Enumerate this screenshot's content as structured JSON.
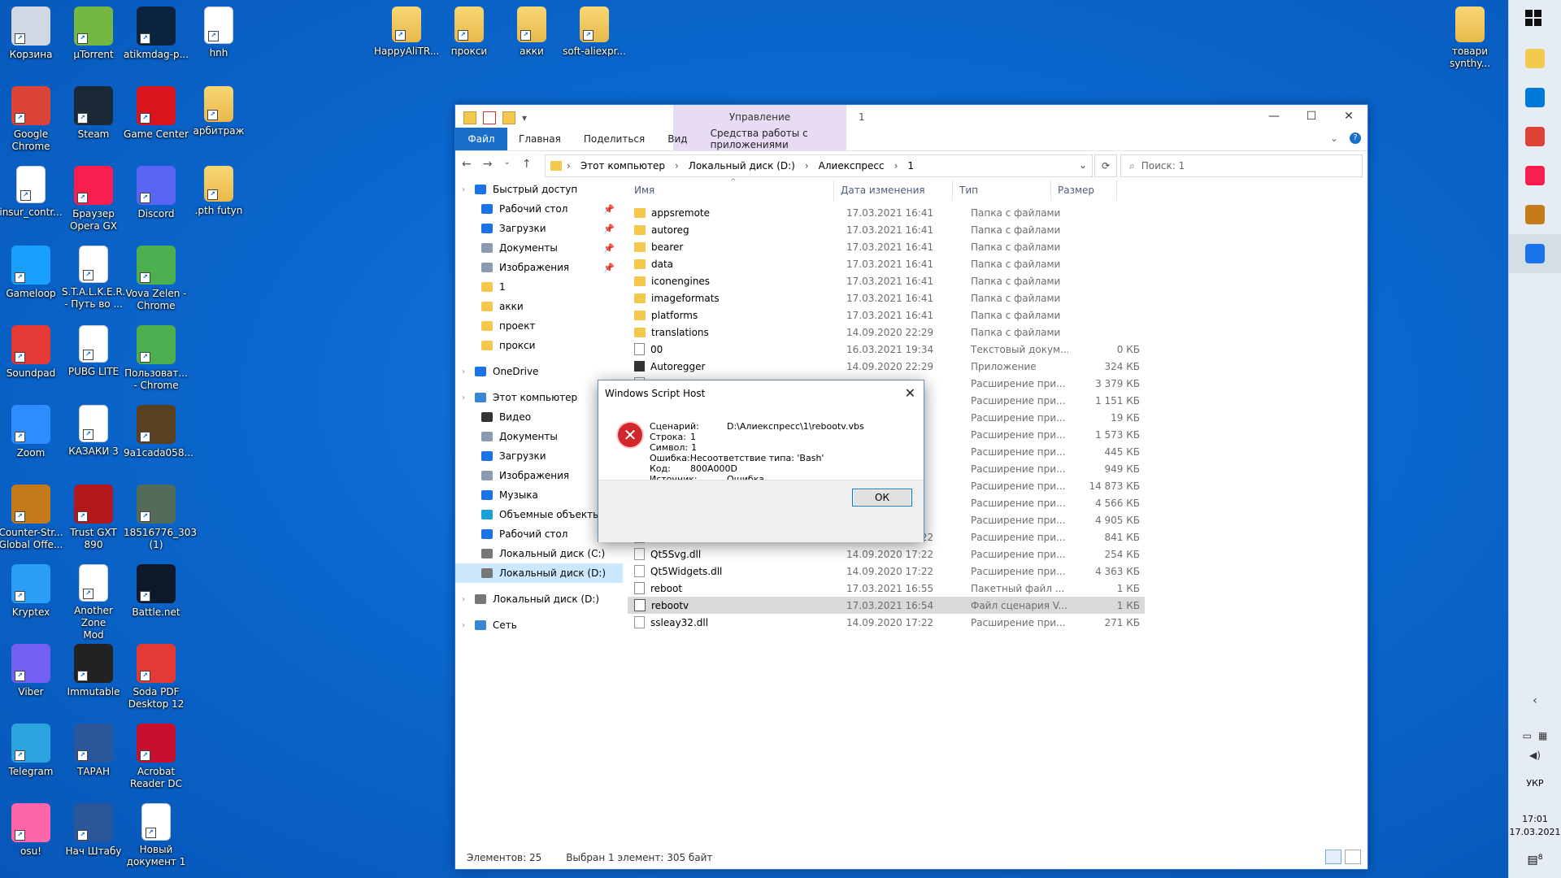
{
  "desktop": {
    "icons_col1": [
      {
        "label": "Корзина",
        "color": "#cfd8e3"
      },
      {
        "label": "Google\nChrome",
        "color": "#db4437"
      },
      {
        "label": "insur_contr...",
        "color": "#ffffff"
      },
      {
        "label": "Gameloop",
        "color": "#19a0ff"
      },
      {
        "label": "Soundpad",
        "color": "#e53935"
      },
      {
        "label": "Zoom",
        "color": "#2d8cff"
      },
      {
        "label": "Counter-Str...\nGlobal Offe...",
        "color": "#c47a1a"
      },
      {
        "label": "Kryptex",
        "color": "#2a9df4"
      },
      {
        "label": "Viber",
        "color": "#7360f2"
      },
      {
        "label": "Telegram",
        "color": "#2aa3df"
      },
      {
        "label": "osu!",
        "color": "#ff66aa"
      }
    ],
    "icons_col2": [
      {
        "label": "µTorrent",
        "color": "#75b841"
      },
      {
        "label": "Steam",
        "color": "#1b2838"
      },
      {
        "label": "Браузер\nOpera GX",
        "color": "#fa1e4e"
      },
      {
        "label": "S.T.A.L.K.E.R.\n- Путь во ...",
        "color": "#ffffff"
      },
      {
        "label": "PUBG LITE",
        "color": "#ffffff"
      },
      {
        "label": "КАЗАКИ 3",
        "color": "#ffffff"
      },
      {
        "label": "Trust GXT 890",
        "color": "#b3161b"
      },
      {
        "label": "Another Zone\nMod",
        "color": "#ffffff"
      },
      {
        "label": "Immutable",
        "color": "#222222"
      },
      {
        "label": "ТАРАН",
        "color": "#2b579a"
      },
      {
        "label": "Нач Штабу",
        "color": "#2b579a"
      }
    ],
    "icons_col3": [
      {
        "label": "atikmdag-p...",
        "color": "#0a2540"
      },
      {
        "label": "Game Center",
        "color": "#d9141c"
      },
      {
        "label": "Discord",
        "color": "#5865f2"
      },
      {
        "label": "Vova Zelen -\nChrome",
        "color": "#4caf50"
      },
      {
        "label": "Пользоват...\n- Chrome",
        "color": "#4caf50"
      },
      {
        "label": "9a1cada058...",
        "color": "#5a4020"
      },
      {
        "label": "18516776_303\n(1)",
        "color": "#556b5a"
      },
      {
        "label": "Battle.net",
        "color": "#0e1a2b"
      },
      {
        "label": "Soda PDF\nDesktop 12",
        "color": "#e53935"
      },
      {
        "label": "Acrobat\nReader DC",
        "color": "#c8102e"
      },
      {
        "label": "Новый\nдокумент 1",
        "color": "#ffffff"
      }
    ],
    "icons_col4": [
      {
        "label": "hnh",
        "color": "#ffffff"
      },
      {
        "label": "арбитраж",
        "color": "#f3c84d"
      },
      {
        "label": ".pth futyn",
        "color": "#f3c84d"
      }
    ],
    "icons_top": [
      {
        "label": "HappyAliTR...",
        "color": "#f3c84d"
      },
      {
        "label": "прокси",
        "color": "#f3c84d"
      },
      {
        "label": "акки",
        "color": "#f3c84d"
      },
      {
        "label": "soft-aliexpr...",
        "color": "#f3c84d"
      }
    ],
    "icon_right": {
      "label": "товари\nsynthy...",
      "color": "#f3c84d"
    }
  },
  "taskbar": {
    "buttons": [
      "windows-icon",
      "file-explorer-icon",
      "mail-icon",
      "chrome-icon",
      "opera-icon",
      "csgo-icon",
      "script-host-icon"
    ],
    "lang": "УКР",
    "time": "17:01",
    "date": "17.03.2021",
    "notifications": "8"
  },
  "explorer": {
    "context_tab_title": "Управление",
    "window_title": "1",
    "ribbon_tabs": [
      "Файл",
      "Главная",
      "Поделиться",
      "Вид",
      "Средства работы с приложениями"
    ],
    "breadcrumbs": [
      "Этот компьютер",
      "Локальный диск (D:)",
      "Алиекспресс",
      "1"
    ],
    "search_placeholder": "Поиск: 1",
    "nav": [
      {
        "label": "Быстрый доступ",
        "icon": "star-icon",
        "color": "#1a73e8",
        "level": 0,
        "pin": false
      },
      {
        "label": "Рабочий стол",
        "icon": "desktop-icon",
        "color": "#1a73e8",
        "level": 1,
        "pin": true
      },
      {
        "label": "Загрузки",
        "icon": "download-icon",
        "color": "#1a73e8",
        "level": 1,
        "pin": true
      },
      {
        "label": "Документы",
        "icon": "documents-icon",
        "color": "#8a9bb0",
        "level": 1,
        "pin": true
      },
      {
        "label": "Изображения",
        "icon": "pictures-icon",
        "color": "#8a9bb0",
        "level": 1,
        "pin": true
      },
      {
        "label": "1",
        "icon": "folder-icon",
        "color": "#f3c84d",
        "level": 1,
        "pin": false
      },
      {
        "label": "акки",
        "icon": "folder-icon",
        "color": "#f3c84d",
        "level": 1,
        "pin": false
      },
      {
        "label": "проект",
        "icon": "folder-icon",
        "color": "#f3c84d",
        "level": 1,
        "pin": false
      },
      {
        "label": "прокси",
        "icon": "folder-icon",
        "color": "#f3c84d",
        "level": 1,
        "pin": false
      },
      {
        "label": "",
        "icon": "",
        "color": "",
        "level": -1,
        "pin": false
      },
      {
        "label": "OneDrive",
        "icon": "cloud-icon",
        "color": "#1a73e8",
        "level": 0,
        "pin": false
      },
      {
        "label": "",
        "icon": "",
        "color": "",
        "level": -1,
        "pin": false
      },
      {
        "label": "Этот компьютер",
        "icon": "computer-icon",
        "color": "#3a86d4",
        "level": 0,
        "pin": false
      },
      {
        "label": "Видео",
        "icon": "video-icon",
        "color": "#333",
        "level": 1,
        "pin": false
      },
      {
        "label": "Документы",
        "icon": "documents-icon",
        "color": "#8a9bb0",
        "level": 1,
        "pin": false
      },
      {
        "label": "Загрузки",
        "icon": "download-icon",
        "color": "#1a73e8",
        "level": 1,
        "pin": false
      },
      {
        "label": "Изображения",
        "icon": "pictures-icon",
        "color": "#8a9bb0",
        "level": 1,
        "pin": false
      },
      {
        "label": "Музыка",
        "icon": "music-icon",
        "color": "#1a73e8",
        "level": 1,
        "pin": false
      },
      {
        "label": "Объемные объекты",
        "icon": "3d-objects-icon",
        "color": "#1aa0d8",
        "level": 1,
        "pin": false
      },
      {
        "label": "Рабочий стол",
        "icon": "desktop-icon",
        "color": "#1a73e8",
        "level": 1,
        "pin": false
      },
      {
        "label": "Локальный диск (C:)",
        "icon": "drive-icon",
        "color": "#777",
        "level": 1,
        "pin": false
      },
      {
        "label": "Локальный диск (D:)",
        "icon": "drive-icon",
        "color": "#777",
        "level": 1,
        "pin": false,
        "selected": true
      },
      {
        "label": "",
        "icon": "",
        "color": "",
        "level": -1,
        "pin": false
      },
      {
        "label": "Локальный диск (D:)",
        "icon": "drive-icon",
        "color": "#777",
        "level": 0,
        "pin": false
      },
      {
        "label": "",
        "icon": "",
        "color": "",
        "level": -1,
        "pin": false
      },
      {
        "label": "Сеть",
        "icon": "network-icon",
        "color": "#3a86d4",
        "level": 0,
        "pin": false
      }
    ],
    "columns": [
      "Имя",
      "Дата изменения",
      "Тип",
      "Размер"
    ],
    "files": [
      {
        "name": "appsremote",
        "date": "17.03.2021 16:41",
        "type": "Папка с файлами",
        "size": "",
        "kind": "folder"
      },
      {
        "name": "autoreg",
        "date": "17.03.2021 16:41",
        "type": "Папка с файлами",
        "size": "",
        "kind": "folder"
      },
      {
        "name": "bearer",
        "date": "17.03.2021 16:41",
        "type": "Папка с файлами",
        "size": "",
        "kind": "folder"
      },
      {
        "name": "data",
        "date": "17.03.2021 16:41",
        "type": "Папка с файлами",
        "size": "",
        "kind": "folder"
      },
      {
        "name": "iconengines",
        "date": "17.03.2021 16:41",
        "type": "Папка с файлами",
        "size": "",
        "kind": "folder"
      },
      {
        "name": "imageformats",
        "date": "17.03.2021 16:41",
        "type": "Папка с файлами",
        "size": "",
        "kind": "folder"
      },
      {
        "name": "platforms",
        "date": "17.03.2021 16:41",
        "type": "Папка с файлами",
        "size": "",
        "kind": "folder"
      },
      {
        "name": "translations",
        "date": "14.09.2020 22:29",
        "type": "Папка с файлами",
        "size": "",
        "kind": "folder"
      },
      {
        "name": "00",
        "date": "16.03.2021 19:34",
        "type": "Текстовый докум...",
        "size": "0 КБ",
        "kind": "txt"
      },
      {
        "name": "Autoregger",
        "date": "14.09.2020 22:29",
        "type": "Приложение",
        "size": "324 КБ",
        "kind": "exe"
      },
      {
        "name": "",
        "date": "",
        "type": "Расширение при...",
        "size": "3 379 КБ",
        "kind": "dll"
      },
      {
        "name": "",
        "date": "",
        "type": "Расширение при...",
        "size": "1 151 КБ",
        "kind": "dll"
      },
      {
        "name": "",
        "date": "",
        "type": "Расширение при...",
        "size": "19 КБ",
        "kind": "dll"
      },
      {
        "name": "",
        "date": "",
        "type": "Расширение при...",
        "size": "1 573 КБ",
        "kind": "dll"
      },
      {
        "name": "",
        "date": "",
        "type": "Расширение при...",
        "size": "445 КБ",
        "kind": "dll"
      },
      {
        "name": "",
        "date": "",
        "type": "Расширение при...",
        "size": "949 КБ",
        "kind": "dll"
      },
      {
        "name": "",
        "date": "",
        "type": "Расширение при...",
        "size": "14 873 КБ",
        "kind": "dll"
      },
      {
        "name": "",
        "date": "",
        "type": "Расширение при...",
        "size": "4 566 КБ",
        "kind": "dll"
      },
      {
        "name": "",
        "date": "",
        "type": "Расширение при...",
        "size": "4 905 КБ",
        "kind": "dll"
      },
      {
        "name": "Qt5Network.dll",
        "date": "14.09.2020 17:22",
        "type": "Расширение при...",
        "size": "841 КБ",
        "kind": "dll"
      },
      {
        "name": "Qt5Svg.dll",
        "date": "14.09.2020 17:22",
        "type": "Расширение при...",
        "size": "254 КБ",
        "kind": "dll"
      },
      {
        "name": "Qt5Widgets.dll",
        "date": "14.09.2020 17:22",
        "type": "Расширение при...",
        "size": "4 363 КБ",
        "kind": "dll"
      },
      {
        "name": "reboot",
        "date": "17.03.2021 16:55",
        "type": "Пакетный файл ...",
        "size": "1 КБ",
        "kind": "txt"
      },
      {
        "name": "rebootv",
        "date": "17.03.2021 16:54",
        "type": "Файл сценария V...",
        "size": "1 КБ",
        "kind": "vbs",
        "selected": true
      },
      {
        "name": "ssleay32.dll",
        "date": "14.09.2020 17:22",
        "type": "Расширение при...",
        "size": "271 КБ",
        "kind": "dll"
      }
    ],
    "status_count": "Элементов: 25",
    "status_selected": "Выбран 1 элемент: 305 байт"
  },
  "dialog": {
    "title": "Windows Script Host",
    "lines": [
      {
        "k": "Сценарий:",
        "v": "D:\\Алиекспресс\\1\\rebootv.vbs",
        "mode": "far"
      },
      {
        "k": "Строка:",
        "v": "1",
        "mode": "near"
      },
      {
        "k": "Символ:",
        "v": "1",
        "mode": "near"
      },
      {
        "k": "Ошибка:",
        "v": "Несоответствие типа: 'Bash'",
        "mode": "tight"
      },
      {
        "k": "Код:",
        "v": "800A000D",
        "mode": "near"
      },
      {
        "k": "Источник:",
        "v": "Ошибка выполнения Microsoft VBScript",
        "mode": "far"
      }
    ],
    "ok": "ОК"
  }
}
